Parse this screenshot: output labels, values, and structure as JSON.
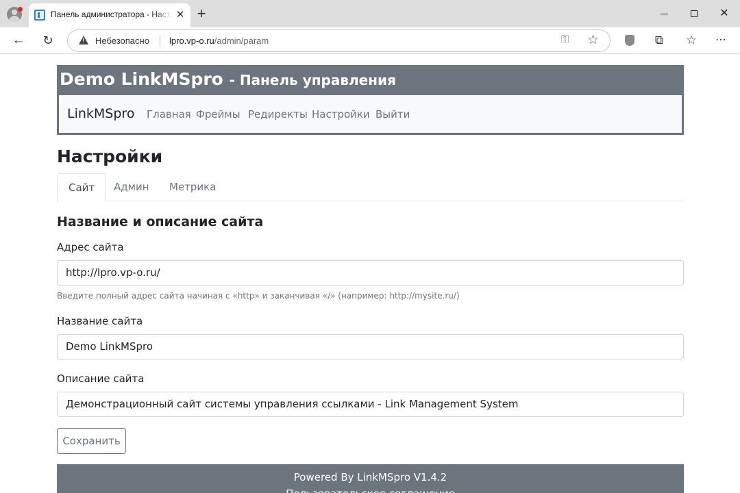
{
  "browser": {
    "tab_title": "Панель администратора - Настройки",
    "tab_close": "✕",
    "new_tab": "+",
    "security_label": "Небезопасно",
    "url_host": "lpro.vp-o.ru",
    "url_path": "/admin/param",
    "icons": [
      "profile-icon",
      "favicon-icon",
      "back-icon",
      "reload-icon",
      "warning-icon",
      "key-icon",
      "star-icon",
      "shield-icon",
      "extensions-icon",
      "favorites-icon",
      "more-icon"
    ]
  },
  "header": {
    "site_name": "Demo LinkMSpro",
    "subtitle": "- Панель управления"
  },
  "navbar": {
    "brand": "LinkMSpro",
    "links": [
      "Главная",
      "Фреймы",
      "Редиректы",
      "Настройки",
      "Выйти"
    ]
  },
  "page": {
    "title": "Настройки",
    "tabs": [
      "Сайт",
      "Админ",
      "Метрика"
    ],
    "active_tab": "Сайт"
  },
  "form": {
    "section_title": "Название и описание сайта",
    "address_label": "Адрес сайта",
    "address_value": "http://lpro.vp-o.ru/",
    "address_help": "Введите полный адрес сайта начиная с «http» и заканчивая «/» (например: http://mysite.ru/)",
    "name_label": "Название сайта",
    "name_value": "Demo LinkMSpro",
    "desc_label": "Описание сайта",
    "desc_value": "Демонстрационный сайт системы управления ссылками - Link Management System",
    "save_label": "Сохранить"
  },
  "footer": {
    "powered": "Powered By LinkMSpro V1.4.2",
    "agreement": "Пользовательское соглашение"
  },
  "colors": {
    "header_bg": "#6c757d",
    "navbar_bg": "#f8f9fa",
    "text": "#212529",
    "muted": "#6c757d"
  }
}
